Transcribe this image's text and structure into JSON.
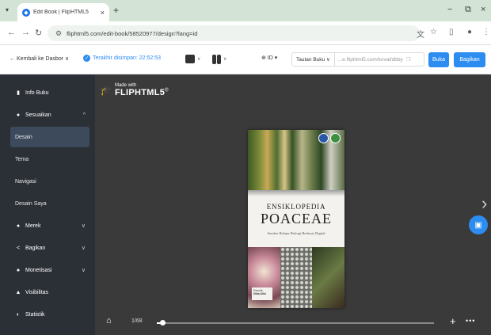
{
  "browser": {
    "tab_title": "Edit Book | FlipHTML5",
    "tab_close": "×",
    "new_tab": "+",
    "menu_glyph": "▾",
    "favicon": "fliphtml5-icon",
    "window_controls": [
      "−",
      "⧉",
      "×"
    ],
    "url": "fliphtml5.com/edit-book/5852097​7/design?lang=id",
    "url_display": "fliphtml5.com/edit-book/58520977/design?lang=id",
    "nav_icons": [
      "back-icon",
      "forward-icon",
      "reload-icon"
    ]
  },
  "toolbar": {
    "back_label": "← Kembali ke Dasbor ∨",
    "saved_label": "Terakhir disimpan: 22:52:53",
    "lang_label": "⊕ ID ▾",
    "link_label": "Tautan Buku ∨",
    "link_value": "...e.fliphtml5.com/koval/dbby",
    "open_label": "Buka",
    "share_label": "Bagikan"
  },
  "sidebar": {
    "items": [
      {
        "label": "Info Buku",
        "icon": "book-icon",
        "chev": ""
      },
      {
        "label": "Sesuaikan",
        "icon": "paint-icon",
        "chev": "^"
      },
      {
        "label": "Desain",
        "icon": "",
        "chev": ""
      },
      {
        "label": "Tema",
        "icon": "",
        "chev": ""
      },
      {
        "label": "Navigasi",
        "icon": "",
        "chev": ""
      },
      {
        "label": "Desain Saya",
        "icon": "",
        "chev": ""
      },
      {
        "label": "Merek",
        "icon": "tag-icon",
        "chev": "∨"
      },
      {
        "label": "Bagikan",
        "icon": "share-icon",
        "chev": "∨"
      },
      {
        "label": "Monetisasi",
        "icon": "money-icon",
        "chev": "∨"
      },
      {
        "label": "Visibilitas",
        "icon": "lock-icon",
        "chev": ""
      },
      {
        "label": "Statistik",
        "icon": "stats-icon",
        "chev": ""
      }
    ]
  },
  "viewer": {
    "made_with": "Made with",
    "brand": "FLIPHTML5",
    "brand_mark": "®",
    "book_title_small": "ENSIKLOPEDIA",
    "book_title_big": "POACEAE",
    "book_subtitle": "Sumber Belajar Biologi Berbasis Digital",
    "authors_label": "Penulis:",
    "author_name": "Diba Alisi",
    "page_indicator": "1/68",
    "progress": 0.02,
    "colors": {
      "accent": "#2d8cf0",
      "sidebar": "#2b2f36",
      "viewer_bg": "#3a3a3a"
    }
  }
}
